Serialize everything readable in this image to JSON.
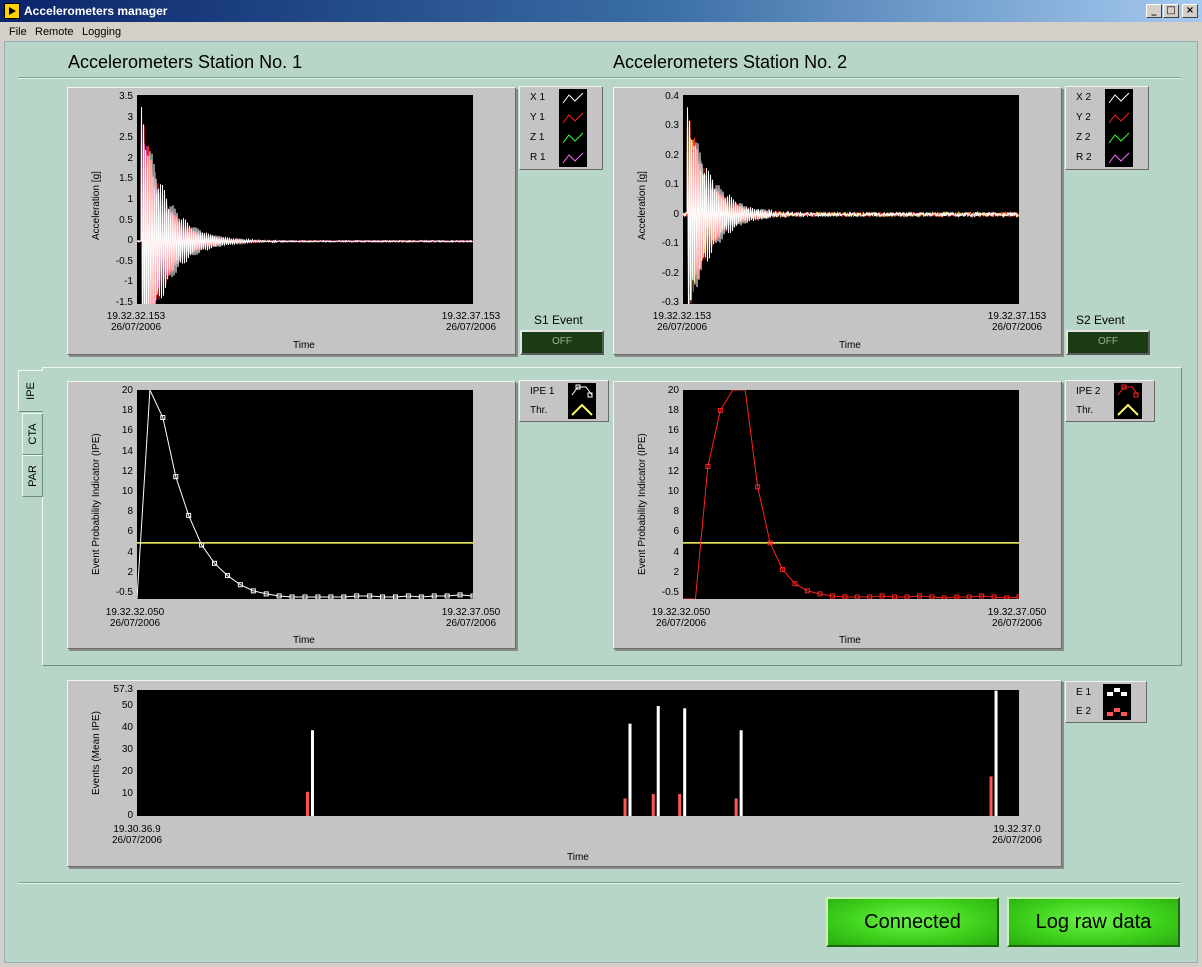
{
  "window": {
    "title": "Accelerometers manager",
    "buttons": [
      "_",
      "□",
      "×"
    ]
  },
  "menu": [
    "File",
    "Remote",
    "Logging"
  ],
  "stations": [
    {
      "title": "Accelerometers Station No. 1",
      "accel": {
        "ylabel": "Acceleration [g]",
        "yticks": [
          "3.5",
          "3",
          "2.5",
          "2",
          "1.5",
          "1",
          "0.5",
          "0",
          "-0.5",
          "-1",
          "-1.5"
        ],
        "x_start": [
          "19.32.32.153",
          "26/07/2006"
        ],
        "x_end": [
          "19.32.37.153",
          "26/07/2006"
        ],
        "xlabel": "Time",
        "legend": [
          "X 1",
          "Y 1",
          "Z 1",
          "R 1"
        ]
      },
      "event": {
        "label": "S1 Event",
        "state": "OFF"
      },
      "ipe": {
        "ylabel": "Event Probability Indicator (IPE)",
        "yticks": [
          "20",
          "18",
          "16",
          "14",
          "12",
          "10",
          "8",
          "6",
          "4",
          "2",
          "-0.5"
        ],
        "x_start": [
          "19.32.32.050",
          "26/07/2006"
        ],
        "x_end": [
          "19.32.37.050",
          "26/07/2006"
        ],
        "xlabel": "Time",
        "legend": [
          "IPE 1",
          "Thr."
        ]
      }
    },
    {
      "title": "Accelerometers Station No. 2",
      "accel": {
        "ylabel": "Acceleration [g]",
        "yticks": [
          "0.4",
          "0.3",
          "0.2",
          "0.1",
          "0",
          "-0.1",
          "-0.2",
          "-0.3"
        ],
        "x_start": [
          "19.32.32.153",
          "26/07/2006"
        ],
        "x_end": [
          "19.32.37.153",
          "26/07/2006"
        ],
        "xlabel": "Time",
        "legend": [
          "X 2",
          "Y 2",
          "Z 2",
          "R 2"
        ]
      },
      "event": {
        "label": "S2 Event",
        "state": "OFF"
      },
      "ipe": {
        "ylabel": "Event Probability Indicator (IPE)",
        "yticks": [
          "20",
          "18",
          "16",
          "14",
          "12",
          "10",
          "8",
          "6",
          "4",
          "2",
          "-0.5"
        ],
        "x_start": [
          "19.32.32.050",
          "26/07/2006"
        ],
        "x_end": [
          "19.32.37.050",
          "26/07/2006"
        ],
        "xlabel": "Time",
        "legend": [
          "IPE 2",
          "Thr."
        ]
      }
    }
  ],
  "tabs": [
    "IPE",
    "CTA",
    "PAR"
  ],
  "events_chart": {
    "ylabel": "Events (Mean IPE)",
    "yticks": [
      "57.3",
      "50",
      "40",
      "30",
      "20",
      "10",
      "0"
    ],
    "x_start": [
      "19.30.36.9",
      "26/07/2006"
    ],
    "x_end": [
      "19.32.37.0",
      "26/07/2006"
    ],
    "xlabel": "Time",
    "legend": [
      "E 1",
      "E 2"
    ]
  },
  "buttons": {
    "connected": "Connected",
    "log_raw": "Log raw data"
  },
  "colors": {
    "trace_white": "#ffffff",
    "trace_red": "#ff2020",
    "trace_green": "#33ff33",
    "trace_magenta": "#ff66ff",
    "threshold": "#ffff66",
    "e2_bar": "#ff5555",
    "panel_bg": "#b8d6c8",
    "button_green": "#3fd21c"
  },
  "chart_data": [
    {
      "type": "line",
      "title": "Station 1 acceleration",
      "series": [
        {
          "name": "X 1",
          "description": "decaying oscillation starting near 3.4 g, settles near 0 by about 20% of window"
        },
        {
          "name": "Y 1"
        },
        {
          "name": "Z 1"
        },
        {
          "name": "R 1"
        }
      ],
      "ylim": [
        -1.5,
        3.5
      ]
    },
    {
      "type": "line",
      "title": "Station 2 acceleration",
      "series": [
        {
          "name": "X 2"
        },
        {
          "name": "Y 2"
        },
        {
          "name": "Z 2"
        },
        {
          "name": "R 2"
        }
      ],
      "ylim": [
        -0.3,
        0.4
      ]
    },
    {
      "type": "line",
      "title": "IPE 1",
      "series": [
        {
          "name": "IPE 1",
          "values": [
            -0.5,
            20,
            17.3,
            11.5,
            7.7,
            4.8,
            3.0,
            1.8,
            0.9,
            0.3,
            0.0,
            -0.2,
            -0.3,
            -0.3,
            -0.3,
            -0.3,
            -0.3,
            -0.2,
            -0.2,
            -0.3,
            -0.3,
            -0.2,
            -0.3,
            -0.2,
            -0.2,
            -0.1,
            -0.2
          ]
        },
        {
          "name": "Thr.",
          "values": [
            5,
            5
          ]
        }
      ],
      "ylim": [
        -0.5,
        20
      ]
    },
    {
      "type": "line",
      "title": "IPE 2",
      "series": [
        {
          "name": "IPE 2",
          "values": [
            -0.5,
            -0.5,
            12.5,
            18.0,
            20,
            20,
            10.5,
            5.0,
            2.4,
            1.0,
            0.3,
            0.0,
            -0.2,
            -0.3,
            -0.3,
            -0.3,
            -0.2,
            -0.3,
            -0.3,
            -0.2,
            -0.3,
            -0.4,
            -0.3,
            -0.3,
            -0.2,
            -0.3,
            -0.4,
            -0.3
          ]
        },
        {
          "name": "Thr.",
          "values": [
            5,
            5
          ]
        }
      ],
      "ylim": [
        -0.5,
        20
      ]
    },
    {
      "type": "bar",
      "title": "Events",
      "x_frac": [
        0.195,
        0.555,
        0.587,
        0.617,
        0.681,
        0.97
      ],
      "series": [
        {
          "name": "E 1",
          "values": [
            39,
            42,
            50,
            49,
            39,
            57
          ]
        },
        {
          "name": "E 2",
          "values": [
            11,
            8,
            10,
            10,
            8,
            18
          ]
        }
      ],
      "ylim": [
        0,
        57.3
      ]
    }
  ]
}
